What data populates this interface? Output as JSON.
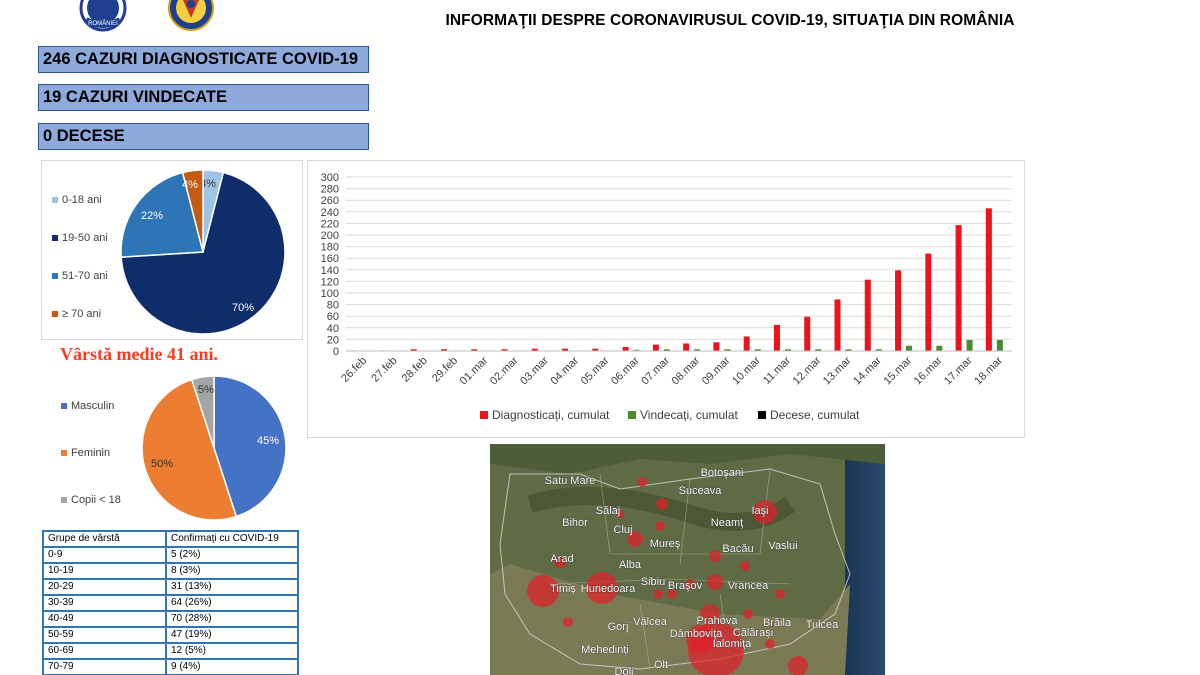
{
  "header": {
    "title": "INFORMAŢII DESPRE CORONAVIRUSUL COVID-19, SITUAŢIA DIN ROMÂNIA",
    "logo_left_text": "ROMÂNIEI"
  },
  "stats": {
    "diagnosed": "246 CAZURI DIAGNOSTICATE COVID-19",
    "recovered": "19 CAZURI VINDECATE",
    "deaths": "0 DECESE"
  },
  "average_age": "Vârstă medie 41 ani.",
  "chart_data": [
    {
      "type": "pie",
      "labels": [
        "0-18 ani",
        "19-50 ani",
        "51-70 ani",
        "≥ 70 ani"
      ],
      "values": [
        4,
        70,
        22,
        4
      ],
      "data_labels": [
        "4%",
        "70%",
        "22%",
        "4%"
      ],
      "colors": [
        "#9dc3e6",
        "#0f2d6b",
        "#2e75b6",
        "#c55a11"
      ],
      "legend": "left"
    },
    {
      "type": "pie",
      "labels": [
        "Masculin",
        "Feminin",
        "Copii < 18"
      ],
      "values": [
        45,
        50,
        5
      ],
      "data_labels": [
        "45%",
        "50%",
        "5%"
      ],
      "colors": [
        "#4472c4",
        "#ed7d31",
        "#a5a5a5"
      ],
      "legend": "left"
    },
    {
      "type": "bar",
      "categories": [
        "26.feb",
        "27.feb",
        "28.feb",
        "29.feb",
        "01.mar",
        "02.mar",
        "03.mar",
        "04.mar",
        "05.mar",
        "06.mar",
        "07.mar",
        "08.mar",
        "09.mar",
        "10.mar",
        "11.mar",
        "12.mar",
        "13.mar",
        "14.mar",
        "15.mar",
        "16.mar",
        "17.mar",
        "18.mar"
      ],
      "series": [
        {
          "name": "Diagnosticați, cumulat",
          "color": "#e8151c",
          "values": [
            1,
            1,
            3,
            3,
            3,
            3,
            4,
            4,
            4,
            7,
            11,
            13,
            15,
            25,
            45,
            59,
            89,
            123,
            139,
            168,
            217,
            246
          ]
        },
        {
          "name": "Vindecați, cumulat",
          "color": "#4c8a2e",
          "values": [
            0,
            0,
            0,
            0,
            0,
            0,
            0,
            1,
            1,
            2,
            3,
            3,
            3,
            3,
            3,
            3,
            3,
            3,
            9,
            9,
            19,
            19
          ]
        },
        {
          "name": "Decese, cumulat",
          "color": "#000000",
          "values": [
            0,
            0,
            0,
            0,
            0,
            0,
            0,
            0,
            0,
            0,
            0,
            0,
            0,
            0,
            0,
            0,
            0,
            0,
            0,
            0,
            0,
            0
          ]
        }
      ],
      "yticks": [
        "0",
        "20",
        "40",
        "60",
        "80",
        "100",
        "120",
        "140",
        "160",
        "180",
        "200",
        "220",
        "240",
        "260",
        "280",
        "300"
      ],
      "ylim": [
        0,
        300
      ],
      "grid": true,
      "legend": "bottom"
    }
  ],
  "age_table": {
    "headers": [
      "Grupe de vârstă",
      "Confirmaţi cu COVID-19"
    ],
    "rows": [
      [
        "0-9",
        "5 (2%)"
      ],
      [
        "10-19",
        "8 (3%)"
      ],
      [
        "20-29",
        "31 (13%)"
      ],
      [
        "30-39",
        "64 (26%)"
      ],
      [
        "40-49",
        "70 (28%)"
      ],
      [
        "50-59",
        "47 (19%)"
      ],
      [
        "60-69",
        "12 (5%)"
      ],
      [
        "70-79",
        "9 (4%)"
      ]
    ]
  },
  "map": {
    "labels": [
      "Satu Mare",
      "Botoşani",
      "Suceava",
      "Sălaj",
      "Iaşi",
      "Bihor",
      "Neamţ",
      "Cluj",
      "Mureş",
      "Bacău",
      "Vaslui",
      "Arad",
      "Alba",
      "Sibiu",
      "Braşov",
      "Vrancea",
      "Timiş",
      "Hunedoara",
      "Prahova",
      "Brăila",
      "Tulcea",
      "Gorj",
      "Vâlcea",
      "Dâmboviţa",
      "Ialomiţa",
      "Mehedinţi",
      "Călăraşi",
      "Olt",
      "Dolj"
    ]
  }
}
